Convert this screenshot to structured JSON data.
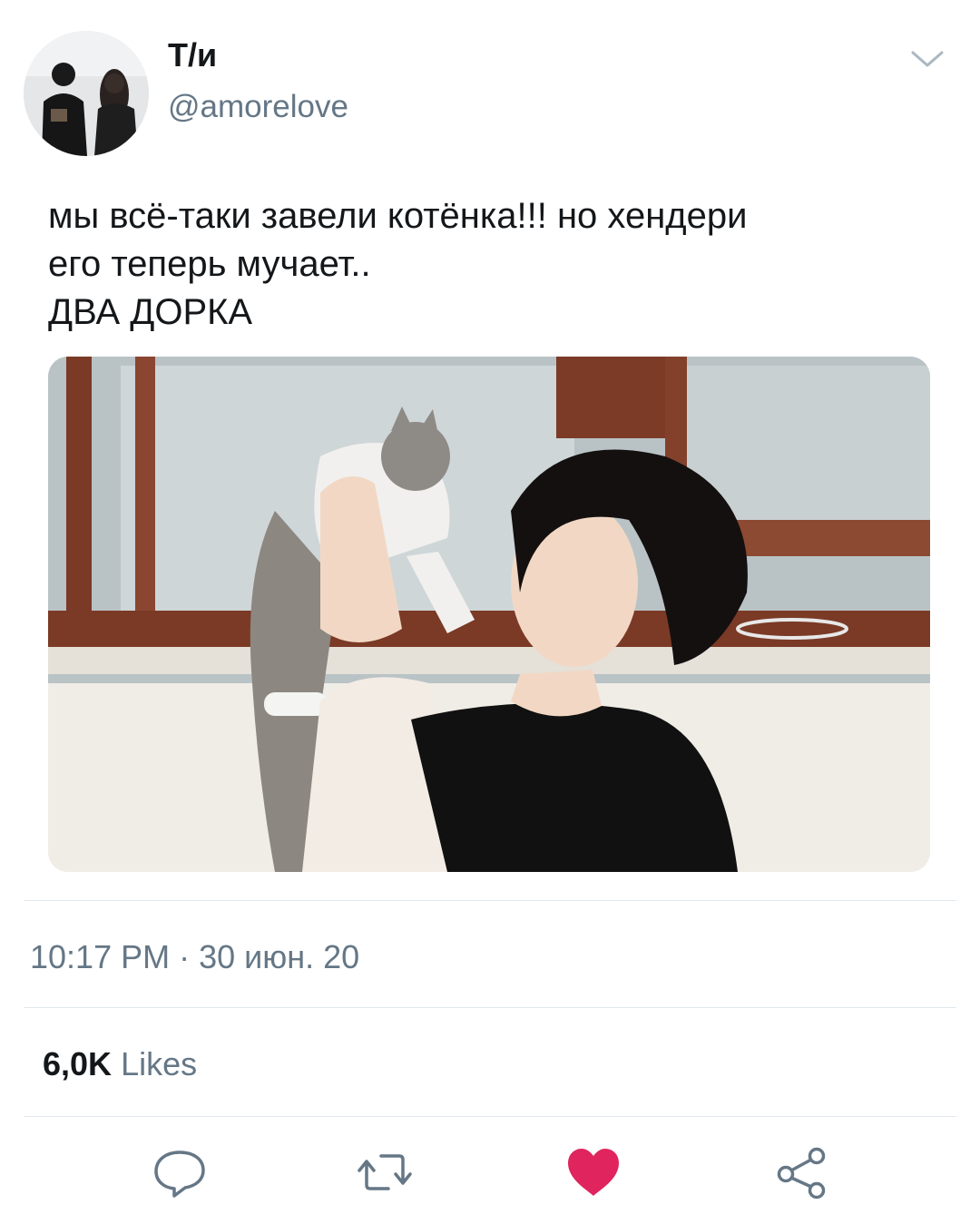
{
  "user": {
    "display_name": "Т/и",
    "handle": "@amorelove"
  },
  "tweet": {
    "lines": [
      "мы всё-таки завели котёнка!!! но хендери",
      "его теперь мучает..",
      "ДВА ДОРКА"
    ],
    "timestamp": "10:17 PM · 30 июн. 20"
  },
  "stats": {
    "likes_count": "6,0K",
    "likes_label": "Likes"
  },
  "colors": {
    "text_primary": "#14171a",
    "text_secondary": "#657786",
    "icon_gray": "#657786",
    "like_red": "#e0245e",
    "divider": "#e1e8ed"
  },
  "icons": {
    "more": "chevron-down-icon",
    "reply": "reply-icon",
    "retweet": "retweet-icon",
    "like": "heart-icon",
    "share": "share-icon"
  }
}
